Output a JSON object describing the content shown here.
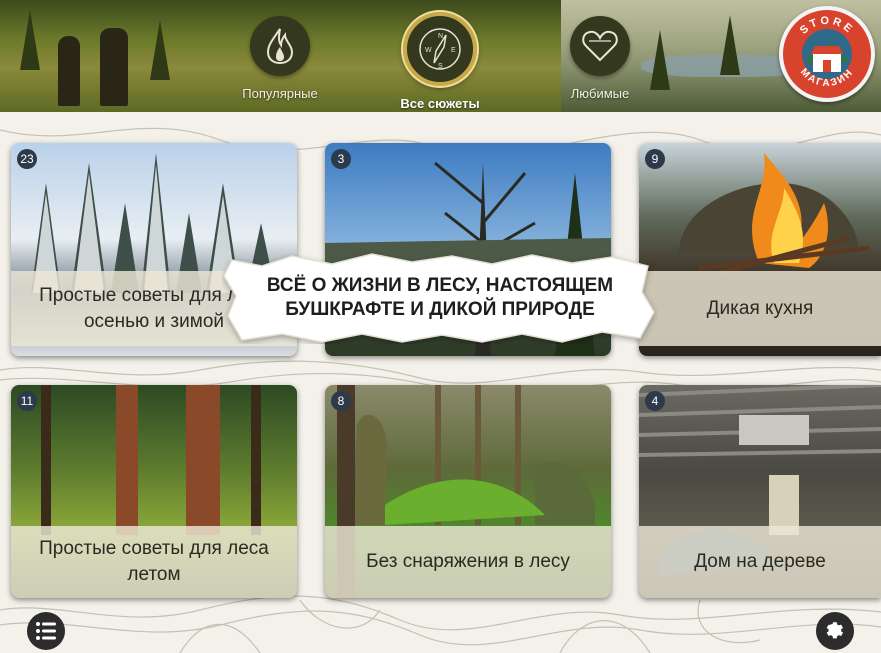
{
  "nav": {
    "tabs": [
      {
        "label": "Популярные",
        "icon": "flame-icon"
      },
      {
        "label": "Все сюжеты",
        "icon": "compass-icon",
        "active": true
      },
      {
        "label": "Любимые",
        "icon": "heart-icon"
      }
    ],
    "store": {
      "top_text": "STORE",
      "bottom_text": "МАГАЗИН",
      "icon": "store-icon",
      "color": "#d8432e"
    }
  },
  "cards": [
    {
      "count": "23",
      "title": "Простые советы для леса осенью и зимой"
    },
    {
      "count": "3",
      "title": ""
    },
    {
      "count": "9",
      "title": "Дикая кухня"
    },
    {
      "count": "11",
      "title": "Простые советы для леса летом"
    },
    {
      "count": "8",
      "title": "Без снаряжения в лесу"
    },
    {
      "count": "4",
      "title": "Дом на дереве"
    }
  ],
  "banner": {
    "text": "ВСЁ О ЖИЗНИ В ЛЕСУ, НАСТОЯЩЕМ БУШКРАФТЕ И ДИКОЙ ПРИРОДЕ"
  },
  "bottom": {
    "menu_icon": "list-menu-icon",
    "settings_icon": "gear-icon"
  },
  "colors": {
    "accent_gold": "#c8a94a",
    "badge": "#2c3a4c",
    "background": "#f3f1ea"
  }
}
